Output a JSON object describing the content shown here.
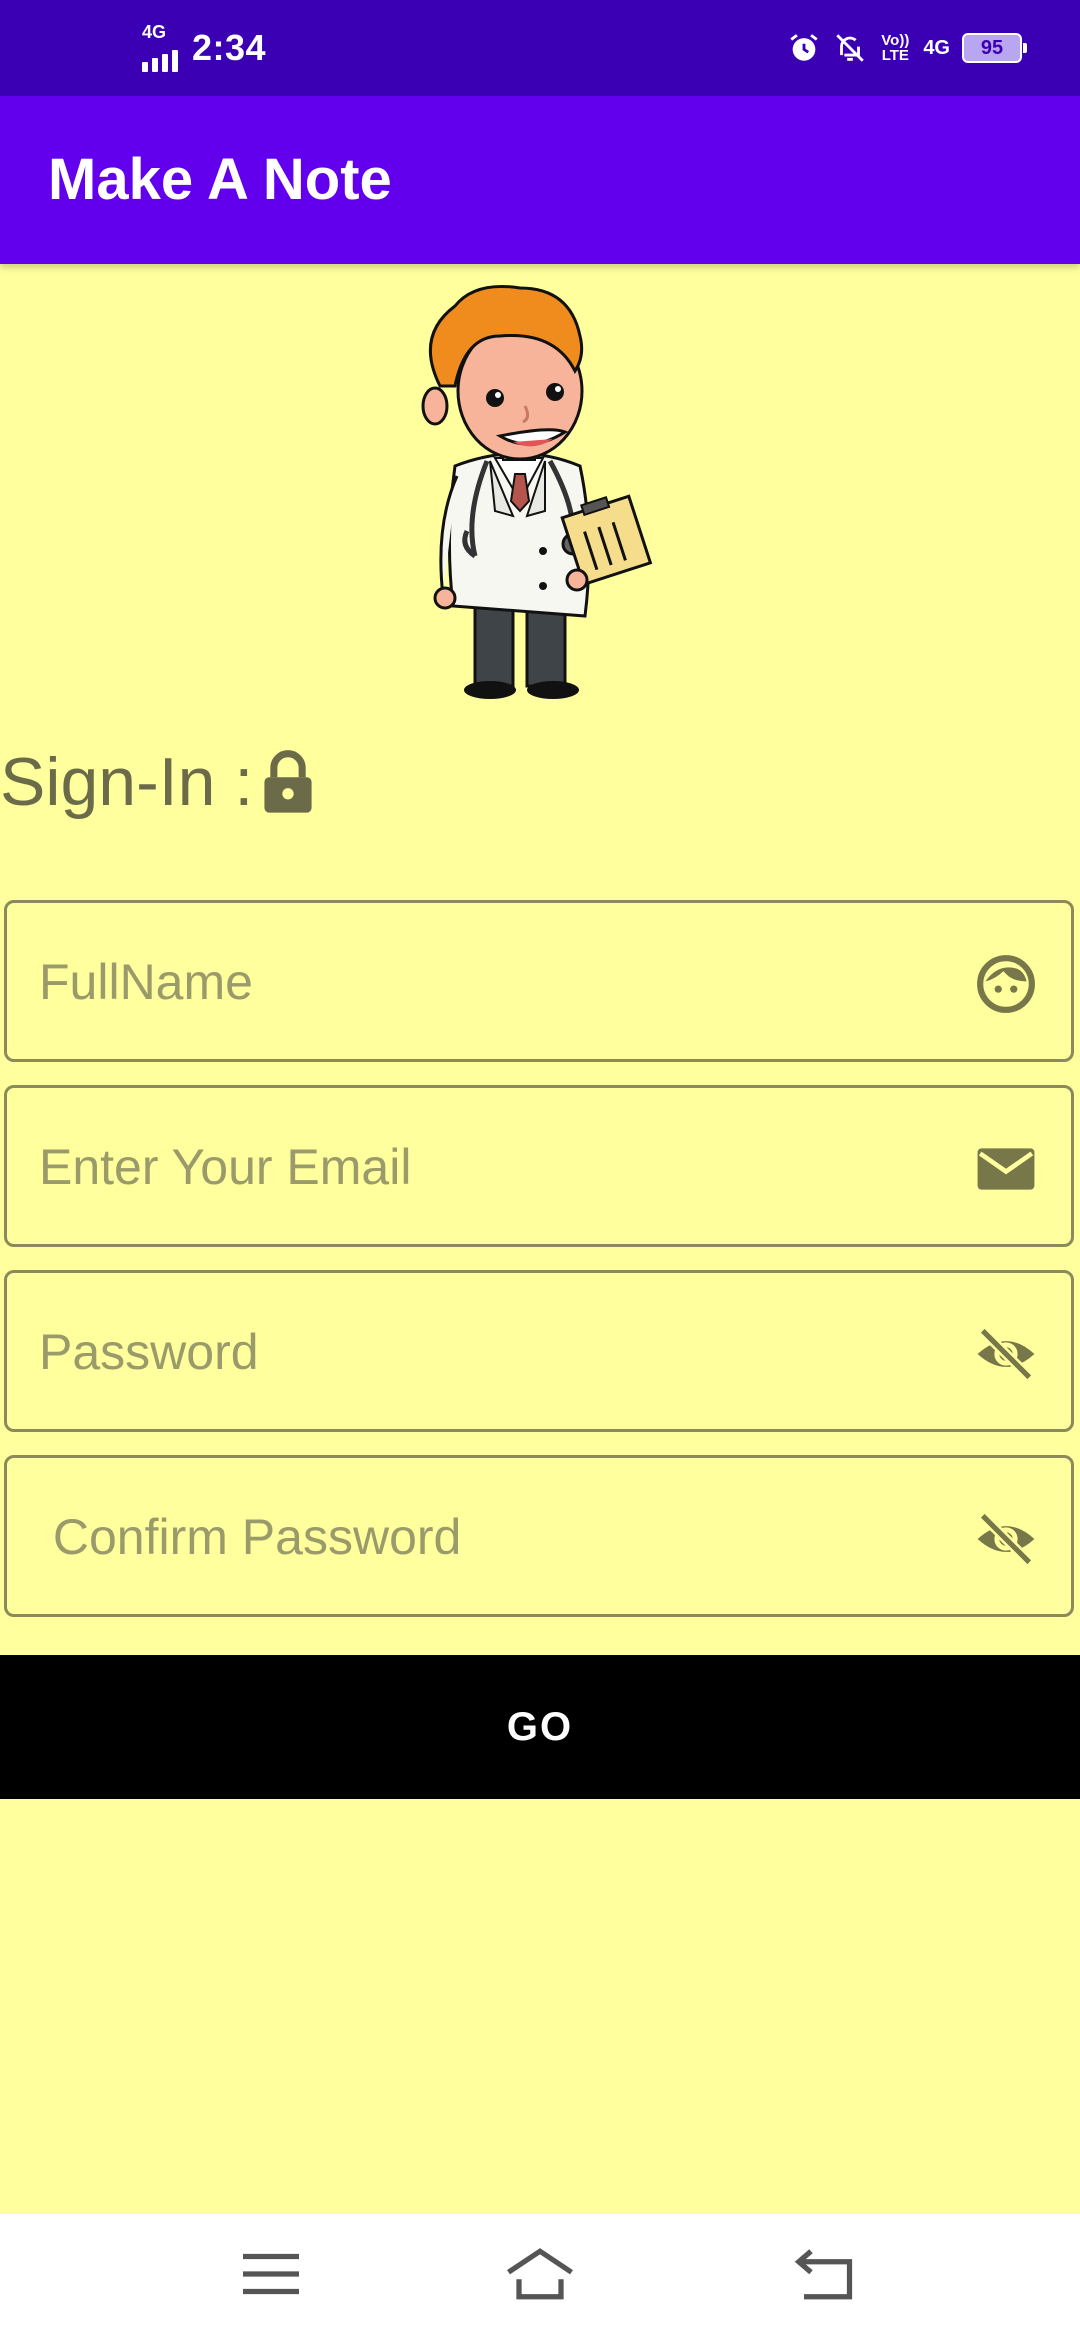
{
  "status_bar": {
    "network": "4G",
    "time": "2:34",
    "volte": "Vo)) LTE",
    "net_right": "4G",
    "battery": "95",
    "icons": [
      "alarm-icon",
      "notifications-off-icon",
      "volte-icon",
      "4g-icon",
      "battery-icon"
    ]
  },
  "app_bar": {
    "title": "Make A Note"
  },
  "illustration": {
    "name": "doctor-cartoon"
  },
  "signin": {
    "heading": "Sign-In :",
    "icon": "lock-icon"
  },
  "form": {
    "fullname": {
      "placeholder": "FullName",
      "value": "",
      "icon": "face-icon"
    },
    "email": {
      "placeholder": "Enter Your Email",
      "value": "",
      "icon": "email-icon"
    },
    "password": {
      "placeholder": "Password",
      "value": "",
      "icon": "visibility-off-icon"
    },
    "confirm_password": {
      "placeholder": " Confirm Password",
      "value": "",
      "icon": "visibility-off-icon"
    }
  },
  "go_button": {
    "label": "GO"
  },
  "nav": {
    "buttons": [
      "menu-icon",
      "home-icon",
      "back-icon"
    ]
  },
  "colors": {
    "status_bar": "#3c00b4",
    "app_bar": "#6200ee",
    "background": "#ffff9e",
    "button": "#000000",
    "icon": "#77774a"
  }
}
